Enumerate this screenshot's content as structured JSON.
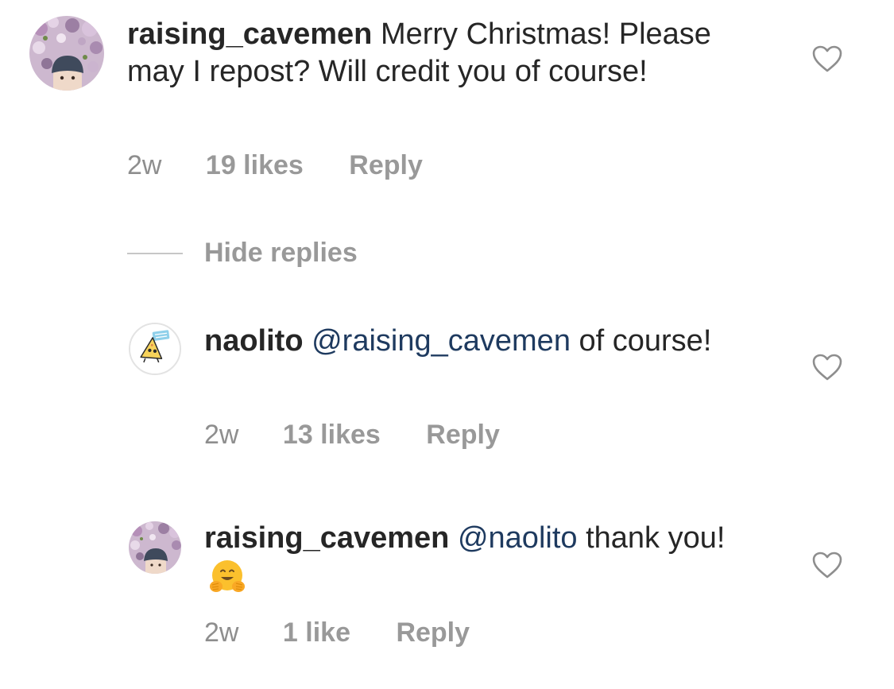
{
  "comments": [
    {
      "username": "raising_cavemen",
      "mention": "",
      "text": " Merry Christmas! Please may I repost? Will credit you of course!",
      "time": "2w",
      "likes": "19 likes",
      "reply_label": "Reply"
    },
    {
      "username": "naolito",
      "mention": "@raising_cavemen",
      "text": " of course!",
      "time": "2w",
      "likes": "13 likes",
      "reply_label": "Reply"
    },
    {
      "username": "raising_cavemen",
      "mention": "@naolito",
      "text": " thank you!",
      "emoji": "hugging-face",
      "time": "2w",
      "likes": "1 like",
      "reply_label": "Reply"
    }
  ],
  "replies_toggle": {
    "label": "Hide replies"
  },
  "icons": {
    "like": "heart-outline-icon"
  },
  "colors": {
    "text": "#262626",
    "meta": "#8e8e8e",
    "mention": "#1e3a5f",
    "divider": "#c7c7c7"
  }
}
